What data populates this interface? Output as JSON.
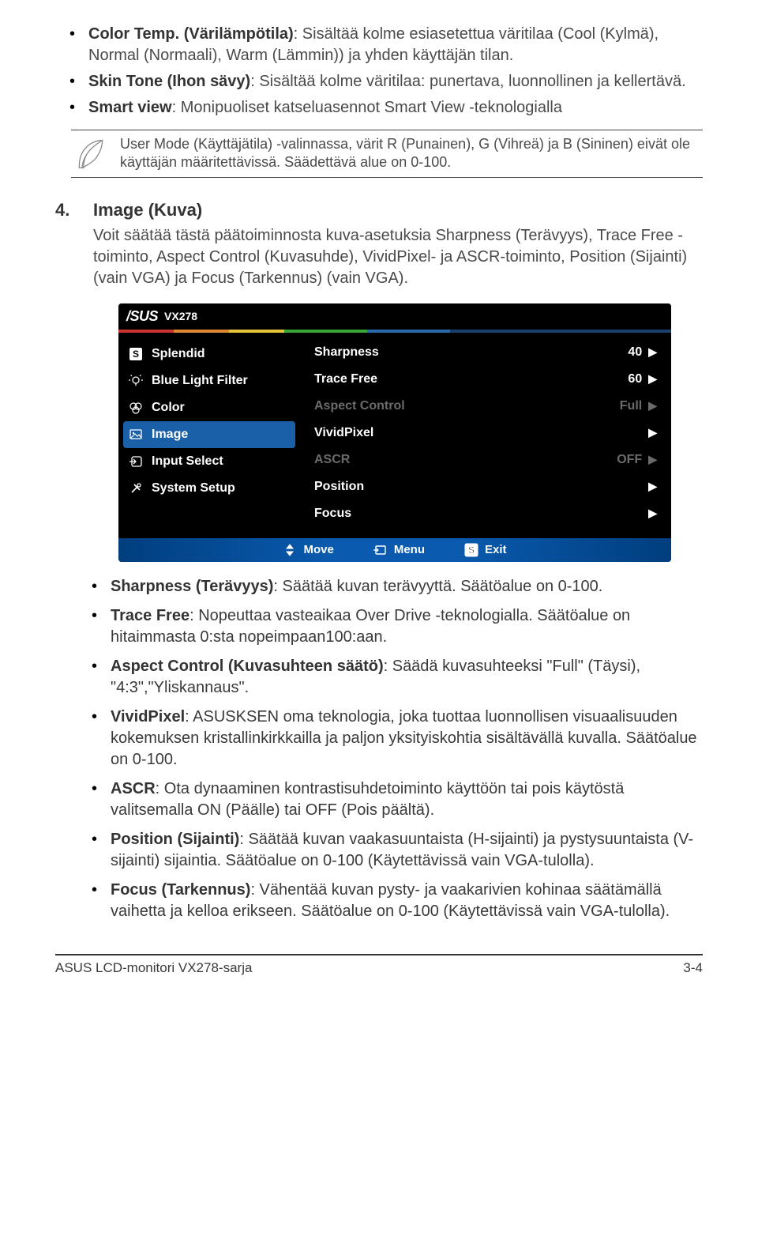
{
  "top_bullets": [
    {
      "strong": "Color Temp. (Värilämpötila)",
      "rest": ": Sisältää kolme esiasetettua väritilaa (Cool (Kylmä), Normal (Normaali), Warm (Lämmin)) ja yhden käyttäjän tilan."
    },
    {
      "strong": "Skin Tone (Ihon sävy)",
      "rest": ": Sisältää kolme väritilaa: punertava, luonnollinen ja kellertävä."
    },
    {
      "strong": "Smart view",
      "rest": ": Monipuoliset katseluasennot Smart View -teknologialla"
    }
  ],
  "note_text": "User Mode (Käyttäjätila) -valinnassa, värit R (Punainen), G (Vihreä) ja B (Sininen) eivät ole käyttäjän määritettävissä. Säädettävä alue on 0-100.",
  "section": {
    "num": "4.",
    "title": "Image (Kuva)",
    "body": "Voit säätää tästä päätoiminnosta kuva-asetuksia Sharpness (Terävyys), Trace Free -toiminto, Aspect Control (Kuvasuhde), VividPixel- ja ASCR-toiminto, Position (Sijainti) (vain VGA) ja Focus (Tarkennus) (vain VGA)."
  },
  "osd": {
    "logo": "/SUS",
    "model": "VX278",
    "menu": [
      {
        "icon": "s-box",
        "name": "menu-splendid",
        "label": "Splendid"
      },
      {
        "icon": "bulb",
        "name": "menu-bluelight",
        "label": "Blue Light Filter"
      },
      {
        "icon": "palette",
        "name": "menu-color",
        "label": "Color"
      },
      {
        "icon": "image",
        "name": "menu-image",
        "label": "Image",
        "selected": true
      },
      {
        "icon": "input",
        "name": "menu-input-select",
        "label": "Input Select"
      },
      {
        "icon": "tools",
        "name": "menu-system-setup",
        "label": "System Setup"
      }
    ],
    "rows": [
      {
        "name": "row-sharpness",
        "label": "Sharpness",
        "value": "40",
        "dim": false
      },
      {
        "name": "row-trace-free",
        "label": "Trace Free",
        "value": "60",
        "dim": false
      },
      {
        "name": "row-aspect-control",
        "label": "Aspect Control",
        "value": "Full",
        "dim": true
      },
      {
        "name": "row-vividpixel",
        "label": "VividPixel",
        "value": "",
        "dim": false
      },
      {
        "name": "row-ascr",
        "label": "ASCR",
        "value": "OFF",
        "dim": true
      },
      {
        "name": "row-position",
        "label": "Position",
        "value": "",
        "dim": false
      },
      {
        "name": "row-focus",
        "label": "Focus",
        "value": "",
        "dim": false
      }
    ],
    "footer": {
      "move": "Move",
      "menu": "Menu",
      "exit": "Exit"
    }
  },
  "lower_bullets": [
    {
      "strong": "Sharpness (Terävyys)",
      "rest": ": Säätää kuvan terävyyttä. Säätöalue on 0-100."
    },
    {
      "strong": "Trace Free",
      "rest": ": Nopeuttaa vasteaikaa Over Drive -teknologialla. Säätöalue on hitaimmasta 0:sta nopeimpaan100:aan."
    },
    {
      "strong": "Aspect Control (Kuvasuhteen säätö)",
      "rest": ": Säädä kuvasuhteeksi \"Full\" (Täysi), \"4:3\",\"Yliskannaus\"."
    },
    {
      "strong": "VividPixel",
      "rest": ": ASUSKSEN oma teknologia, joka tuottaa luonnollisen visuaalisuuden kokemuksen kristallinkirkkailla ja paljon yksityiskohtia sisältävällä kuvalla. Säätöalue on 0-100."
    },
    {
      "strong": "ASCR",
      "rest": ": Ota dynaaminen kontrastisuhdetoiminto käyttöön tai pois käytöstä valitsemalla ON (Päälle) tai OFF (Pois päältä)."
    },
    {
      "strong": "Position (Sijainti)",
      "rest": ": Säätää kuvan vaakasuuntaista (H-sijainti) ja pystysuuntaista (V-sijainti) sijaintia. Säätöalue on 0-100 (Käytettävissä vain VGA-tulolla)."
    },
    {
      "strong": "Focus (Tarkennus)",
      "rest": ": Vähentää kuvan pysty- ja vaakarivien kohinaa säätämällä vaihetta ja kelloa erikseen. Säätöalue on 0-100 (Käytettävissä vain VGA-tulolla)."
    }
  ],
  "footer": {
    "left": "ASUS LCD-monitori VX278-sarja",
    "right": "3-4"
  }
}
